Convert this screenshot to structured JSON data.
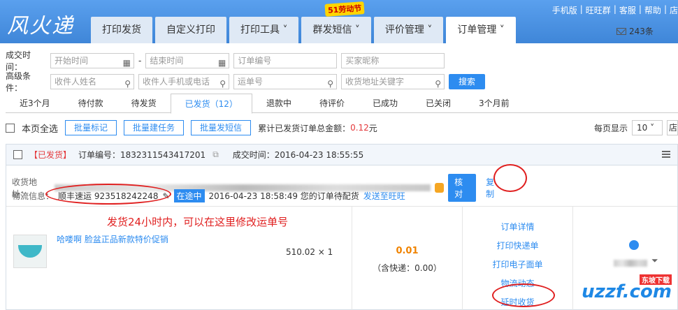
{
  "header": {
    "logo": "风火递",
    "promo": "51劳动节",
    "mail_count": "243条",
    "top_links": [
      "手机版",
      "旺旺群",
      "客服",
      "帮助",
      "店"
    ]
  },
  "nav": [
    "打印发货",
    "自定义打印",
    "打印工具 ˅",
    "群发短信 ˅",
    "评价管理 ˅",
    "订单管理 ˅"
  ],
  "filters": {
    "deal_time_label": "成交时间：",
    "start_placeholder": "开始时间",
    "end_placeholder": "结束时间",
    "dash": "-",
    "order_no_placeholder": "订单编号",
    "buyer_placeholder": "买家昵称",
    "advanced_label": "高级条件：",
    "receiver_name_placeholder": "收件人姓名",
    "receiver_phone_placeholder": "收件人手机或电话",
    "waybill_placeholder": "运单号",
    "address_placeholder": "收货地址关键字",
    "search_button": "搜索"
  },
  "tabs": [
    "近3个月",
    "待付款",
    "待发货",
    "已发货（12）",
    "退款中",
    "待评价",
    "已成功",
    "已关闭",
    "3个月前"
  ],
  "bulk": {
    "select_all": "本页全选",
    "mark": "批量标记",
    "create_task": "批量建任务",
    "sms": "批量发短信",
    "total_label": "累计已发货订单总金额：",
    "total_value": "0.12",
    "total_unit": "元",
    "per_page_label": "每页显示",
    "per_page_value": "10",
    "extra": "店"
  },
  "order": {
    "status": "【已发货】",
    "order_no": "订单编号：1832311543417201",
    "deal_time": "成交时间：2016-04-23 18:55:55",
    "addr_label": "收货地址：",
    "verify": "核对",
    "copy": "复制",
    "logistics_label": "物流信息：",
    "courier": "顺丰速运 923518242248",
    "transit": "在途中",
    "transit_info": "2016-04-23 18:58:49 您的订单待配货",
    "send_ww": "发送至旺旺",
    "note": "发货24小时内，可以在这里修改运单号",
    "item_title": "哈喽啊 脸盆正品新款特价促销",
    "item_price": "510.02 × 1",
    "amount": "0.01",
    "shipping": "（含快递：0.00）",
    "actions": [
      "订单详情",
      "打印快递单",
      "打印电子面单",
      "物流动态",
      "延时收货"
    ],
    "watermark": "uzzf.com",
    "watermark_tag": "东坡下载"
  }
}
